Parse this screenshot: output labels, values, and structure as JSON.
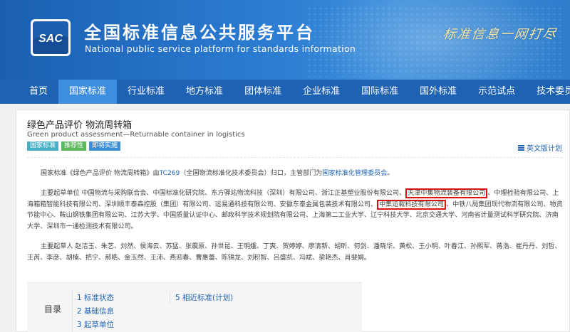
{
  "header": {
    "title": "全国标准信息公共服务平台",
    "subtitle": "National public service platform  for standards information",
    "logo_text": "SAC",
    "slogan": "标准信息一网打尽"
  },
  "nav": {
    "items": [
      "首页",
      "国家标准",
      "行业标准",
      "地方标准",
      "团体标准",
      "企业标准",
      "国际标准",
      "国外标准",
      "示范试点",
      "技术委员会"
    ],
    "active": "国家标准"
  },
  "standard": {
    "title_cn": "绿色产品评价 物流周转箱",
    "title_en": "Green product assessment—Returnable container in logistics",
    "tags": [
      "国家标准",
      "推荐性",
      "即将实施"
    ],
    "english_link": "英文版计划",
    "intro": {
      "text_before": "国家标准《绿色产品评价 物流周转箱》由",
      "committee_code": "TC269",
      "text_middle": "（全国物流标准化技术委员会）归口，主管部门为",
      "department": "国家标准化管理委员会",
      "text_end": "。"
    },
    "drafting_units": {
      "label": "主要起草单位",
      "before": "中国物流与采购联合会、中国标准化研究院、东方驿站物流科技（深圳）有限公司、浙江正基塑业股份有限公司、",
      "highlight1": "天津中集物流装备有限公司",
      "middle": "、中理检验有限公司、上海箱箱智能科技有限公司、深圳顺丰泰森控股（集团）有限公司、运易通科技有限公司、安徽东泰金属包装技术有限公司、",
      "highlight2": "中集运载科技有限公司",
      "after": "、中铁八局集团现代物流有限公司、物资节能中心、鞍山钢铁集团有限公司、江苏大学、中国质量认证中心、邮政科学技术规划院有限公司、上海第二工业大学、辽宁科技大学、北京交通大学、河南省计量测试科学研究院、济南大学、深圳市一通检测技术有限公司。"
    },
    "drafters": {
      "label": "主要起草人",
      "names": "赵洁玉、朱艺、刘然、侯海云、苏猛、张震原、孙世昆、王明娥、丁爽、贺婷婷、廖清新、胡昕、何剑、潘晓华、黄松、王小明、叶春江、孙熙军、蒋浩、崔丹丹、刘哲、王芮、李彦、胡楠、把宁、郝皓、金玉然、王沛、燕迎春、曹惠蕾、陈锦龙、刘积智、吕盛凯、冯斌、梁艳杰、肖斐娟。"
    }
  },
  "toc": {
    "label": "目录",
    "items": [
      "1 标准状态",
      "2 基础信息",
      "3 起草单位",
      "5 相近标准(计划)"
    ]
  },
  "colors": {
    "header_blue": "#1b5fb0",
    "nav_blue": "#1e62b4",
    "nav_active": "#3d8de0",
    "link": "#1e62b4",
    "highlight_border": "#e01010",
    "tag_national": "#45b0c6",
    "tag_recommended": "#5cb85c",
    "tag_upcoming": "#3b8fd6"
  }
}
